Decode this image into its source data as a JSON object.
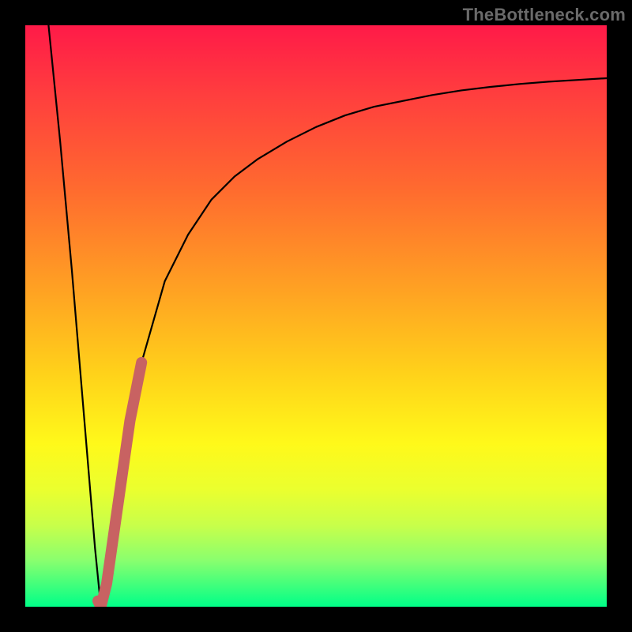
{
  "watermark": "TheBottleneck.com",
  "chart_data": {
    "type": "line",
    "title": "",
    "xlabel": "",
    "ylabel": "",
    "xlim": [
      0,
      100
    ],
    "ylim": [
      0,
      100
    ],
    "grid": false,
    "series": [
      {
        "name": "bottleneck-curve",
        "color": "#000000",
        "x": [
          4,
          6,
          8,
          10,
          12,
          13,
          14,
          16,
          18,
          20,
          24,
          28,
          32,
          36,
          40,
          45,
          50,
          55,
          60,
          65,
          70,
          75,
          80,
          85,
          90,
          95,
          100
        ],
        "values": [
          100,
          80,
          58,
          34,
          10,
          0,
          4,
          18,
          32,
          42,
          56,
          64,
          70,
          74,
          77,
          80,
          82.5,
          84.5,
          86,
          87,
          88,
          88.8,
          89.4,
          89.9,
          90.3,
          90.6,
          90.9
        ]
      },
      {
        "name": "highlight-segment",
        "color": "#c86262",
        "x": [
          12.5,
          13,
          14,
          16,
          18,
          20
        ],
        "values": [
          1,
          0,
          4,
          18,
          32,
          42
        ]
      }
    ]
  }
}
